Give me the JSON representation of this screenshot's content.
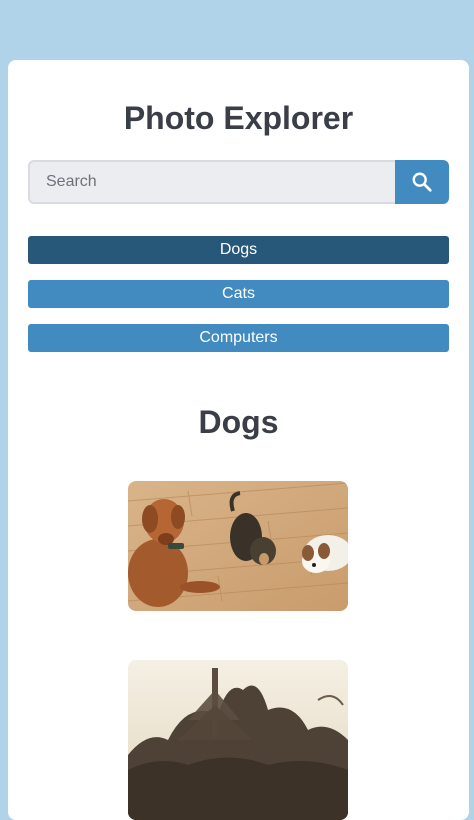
{
  "app": {
    "title": "Photo Explorer"
  },
  "search": {
    "placeholder": "Search",
    "value": "",
    "button_icon": "search-icon"
  },
  "categories": [
    {
      "label": "Dogs",
      "active": true
    },
    {
      "label": "Cats",
      "active": false
    },
    {
      "label": "Computers",
      "active": false
    }
  ],
  "gallery": {
    "heading": "Dogs",
    "photos": [
      {
        "subject": "three dogs on wooden floor"
      },
      {
        "subject": "sepia tree photograph"
      }
    ]
  },
  "colors": {
    "background": "#b0d3ea",
    "accent": "#418bc1",
    "active": "#27587a",
    "heading": "#3a3e47"
  }
}
